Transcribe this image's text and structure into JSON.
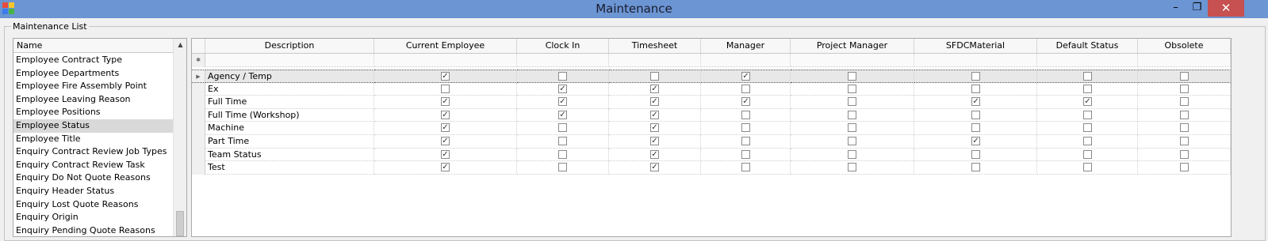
{
  "window": {
    "title": "Maintenance"
  },
  "titlebar": {
    "minimize": "–",
    "maximize": "❐",
    "close": "✕"
  },
  "group": {
    "label": "Maintenance List"
  },
  "list": {
    "header": "Name",
    "selected_index": 5,
    "items": [
      "Employee Contract Type",
      "Employee Departments",
      "Employee Fire Assembly Point",
      "Employee Leaving Reason",
      "Employee Positions",
      "Employee Status",
      "Employee Title",
      "Enquiry Contract Review Job Types",
      "Enquiry Contract Review Task",
      "Enquiry Do Not Quote Reasons",
      "Enquiry Header Status",
      "Enquiry Lost Quote Reasons",
      "Enquiry Origin",
      "Enquiry Pending Quote Reasons"
    ]
  },
  "grid": {
    "columns": [
      "Description",
      "Current Employee",
      "Clock In",
      "Timesheet",
      "Manager",
      "Project Manager",
      "SFDCMaterial",
      "Default Status",
      "Obsolete"
    ],
    "current_row": 0,
    "rows": [
      {
        "description": "Agency / Temp",
        "flags": [
          true,
          false,
          false,
          true,
          false,
          false,
          false,
          false
        ]
      },
      {
        "description": "Ex",
        "flags": [
          false,
          true,
          true,
          false,
          false,
          false,
          false,
          false
        ]
      },
      {
        "description": "Full Time",
        "flags": [
          true,
          true,
          true,
          true,
          false,
          true,
          true,
          false
        ]
      },
      {
        "description": "Full Time (Workshop)",
        "flags": [
          true,
          true,
          true,
          false,
          false,
          false,
          false,
          false
        ]
      },
      {
        "description": "Machine",
        "flags": [
          true,
          false,
          true,
          false,
          false,
          false,
          false,
          false
        ]
      },
      {
        "description": "Part Time",
        "flags": [
          true,
          false,
          true,
          false,
          false,
          true,
          false,
          false
        ]
      },
      {
        "description": "Team Status",
        "flags": [
          true,
          false,
          true,
          false,
          false,
          false,
          false,
          false
        ]
      },
      {
        "description": "Test",
        "flags": [
          true,
          false,
          true,
          false,
          false,
          false,
          false,
          false
        ]
      }
    ]
  },
  "icons": {
    "app": "app-icon",
    "new_row": "asterisk-icon",
    "current_row": "row-pointer-icon",
    "scroll_up": "scroll-up-icon"
  }
}
